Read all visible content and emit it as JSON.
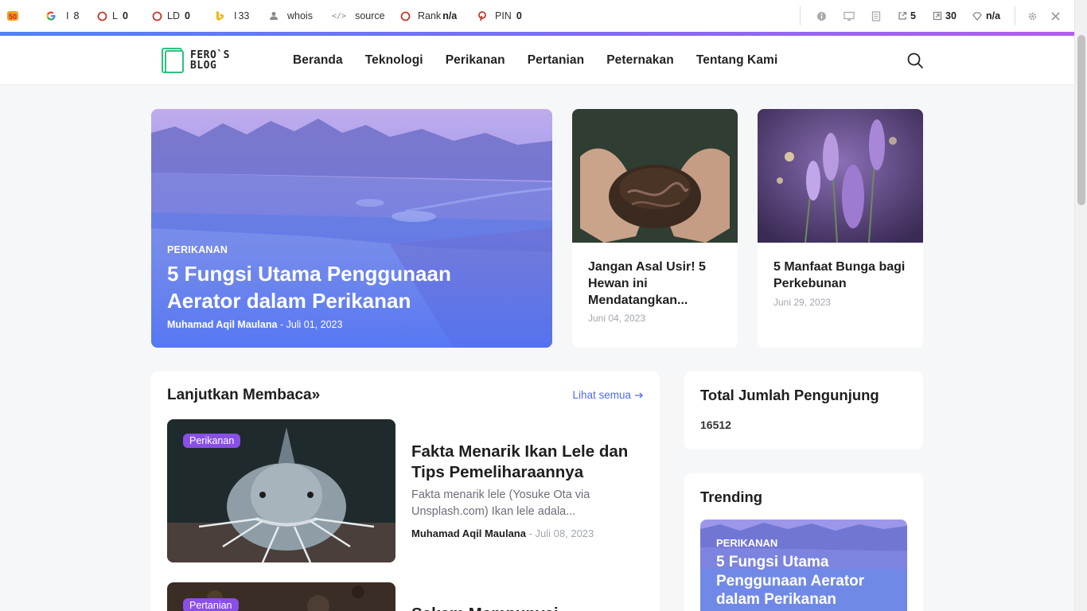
{
  "seo_toolbar": {
    "google_label": "I",
    "google_value": "8",
    "links_label": "L",
    "links_value": "0",
    "ld_label": "LD",
    "ld_value": "0",
    "bing_label": "I",
    "bing_value": "33",
    "whois_label": "whois",
    "source_label": "source",
    "rank_label": "Rank",
    "rank_value": "n/a",
    "pin_label": "PIN",
    "pin_value": "0",
    "external_links": "5",
    "internal_links": "30",
    "diamond_value": "n/a"
  },
  "header": {
    "logo_line1": "FERO`S",
    "logo_line2": "BLOG",
    "nav": [
      "Beranda",
      "Teknologi",
      "Perikanan",
      "Pertanian",
      "Peternakan",
      "Tentang Kami"
    ]
  },
  "hero": {
    "category": "PERIKANAN",
    "title": "5 Fungsi Utama Penggunaan Aerator dalam Perikanan",
    "author": "Muhamad Aqil Maulana",
    "date": "- Juli 01, 2023"
  },
  "side_cards": [
    {
      "title": "Jangan Asal Usir! 5 Hewan ini Mendatangkan...",
      "date": "Juni 04, 2023"
    },
    {
      "title": "5 Manfaat Bunga bagi Perkebunan",
      "date": "Juni 29, 2023"
    }
  ],
  "continue_reading": {
    "title": "Lanjutkan Membaca»",
    "see_all": "Lihat semua",
    "posts": [
      {
        "tag": "Perikanan",
        "title": "Fakta Menarik Ikan Lele dan Tips Pemeliharaannya",
        "excerpt": "Fakta menarik lele (Yosuke Ota via Unsplash.com) Ikan lele adala...",
        "author": "Muhamad Aqil Maulana",
        "date": "- Juli 08, 2023"
      },
      {
        "tag": "Pertanian",
        "title": "Sekam Mempunyai"
      }
    ]
  },
  "visitor_widget": {
    "title": "Total Jumlah Pengunjung",
    "count": "16512"
  },
  "trending_widget": {
    "title": "Trending",
    "category": "PERIKANAN",
    "post_title": "5 Fungsi Utama Penggunaan Aerator dalam Perikanan"
  },
  "colors": {
    "accent": "#4f6bf0",
    "tag_purple": "#8a4fe6"
  }
}
